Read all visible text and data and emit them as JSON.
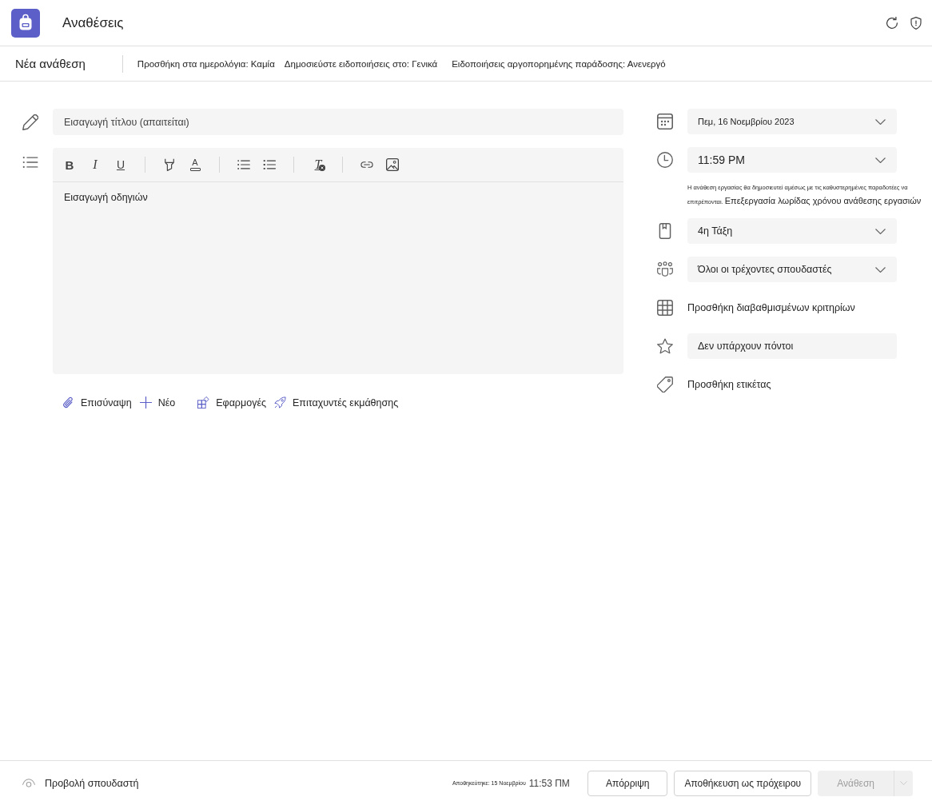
{
  "app_bar": {
    "title": "Αναθέσεις"
  },
  "command_bar": {
    "title": "Νέα ανάθεση",
    "settings": [
      "Προσθήκη στα ημερολόγια: Καμία",
      "Δημοσιεύστε ειδοποιήσεις στο: Γενικά",
      "Ειδοποιήσεις αργοπορημένης παράδοσης: Ανενεργό"
    ]
  },
  "title_field": {
    "placeholder": "Εισαγωγή τίτλου (απαιτείται)"
  },
  "editor": {
    "toolbar": [
      {
        "buttons": [
          {
            "kind": "bold",
            "glyph": "B"
          },
          {
            "kind": "italic",
            "glyph": "I"
          },
          {
            "kind": "underline",
            "glyph": "U"
          }
        ]
      },
      {
        "buttons": [
          {
            "kind": "highlight"
          },
          {
            "kind": "font_color",
            "glyph": "A"
          }
        ]
      },
      {
        "buttons": [
          {
            "kind": "bullets"
          },
          {
            "kind": "numbering"
          }
        ]
      },
      {
        "buttons": [
          {
            "kind": "clear_format",
            "glyph": "T"
          }
        ]
      },
      {
        "buttons": [
          {
            "kind": "link"
          },
          {
            "kind": "image"
          }
        ]
      }
    ],
    "placeholder": "Εισαγωγή οδηγιών"
  },
  "attachments": [
    {
      "kind": "attach",
      "label": "Επισύναψη"
    },
    {
      "kind": "new",
      "label": "Νέο"
    },
    {
      "kind": "apps",
      "label": "Εφαρμογές"
    },
    {
      "kind": "accelerators",
      "label": "Επιταχυντές εκμάθησης"
    }
  ],
  "due_date": {
    "value": "Πεμ, 16 Νοεμβρίου 2023"
  },
  "due_time": {
    "value": "11:59 PM"
  },
  "schedule_note": {
    "text": "Η ανάθεση εργασίας θα δημοσιευτεί αμέσως με τις καθυστερημένες παραδοτέες να επιτρέπονται.",
    "link": "Επεξεργασία λωρίδας χρόνου ανάθεσης εργασιών"
  },
  "class": {
    "value": "4η Τάξη"
  },
  "students": {
    "value": "Όλοι οι τρέχοντες σπουδαστές"
  },
  "rubric": {
    "label": "Προσθήκη διαβαθμισμένων κριτηρίων"
  },
  "points": {
    "value": "Δεν υπάρχουν πόντοι"
  },
  "tag": {
    "label": "Προσθήκη ετικέτας"
  },
  "footer": {
    "student_view": "Προβολή σπουδαστή",
    "saved": "Αποθηκεύτηκε: 15 Νοεμβρίου",
    "saved_time": "11:53 ΠΜ",
    "buttons": [
      {
        "kind": "secondary",
        "label": "Απόρριψη",
        "disabled": false
      },
      {
        "kind": "secondary",
        "label": "Αποθήκευση ως πρόχειρου",
        "disabled": false
      },
      {
        "kind": "primary",
        "label": "Ανάθεση",
        "disabled": true
      }
    ]
  }
}
